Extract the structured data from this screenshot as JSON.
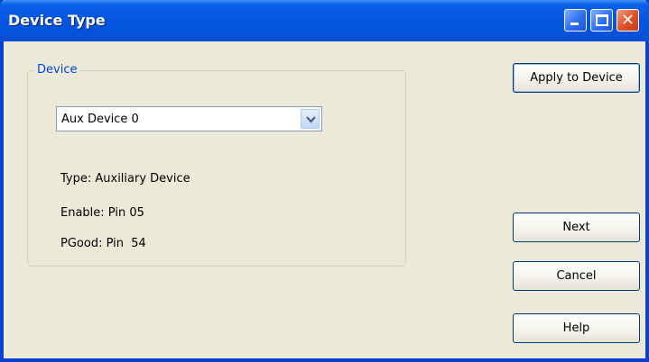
{
  "window": {
    "title": "Device Type"
  },
  "titlebar_buttons": {
    "minimize_icon": "minimize-icon",
    "maximize_icon": "maximize-icon",
    "close_icon": "close-icon",
    "close_glyph": "✕"
  },
  "device_group": {
    "label": "Device",
    "selected_device": "Aux Device 0",
    "type_text": "Type: Auxiliary Device",
    "enable_text": "Enable: Pin 05",
    "pgood_text": "PGood: Pin  54"
  },
  "buttons": {
    "apply": "Apply to Device",
    "next": "Next",
    "cancel": "Cancel",
    "help": "Help"
  },
  "colors": {
    "titlebar": "#0656e0",
    "window_bg": "#ece9d8",
    "group_label": "#0046d5",
    "close_button": "#e0542c"
  }
}
